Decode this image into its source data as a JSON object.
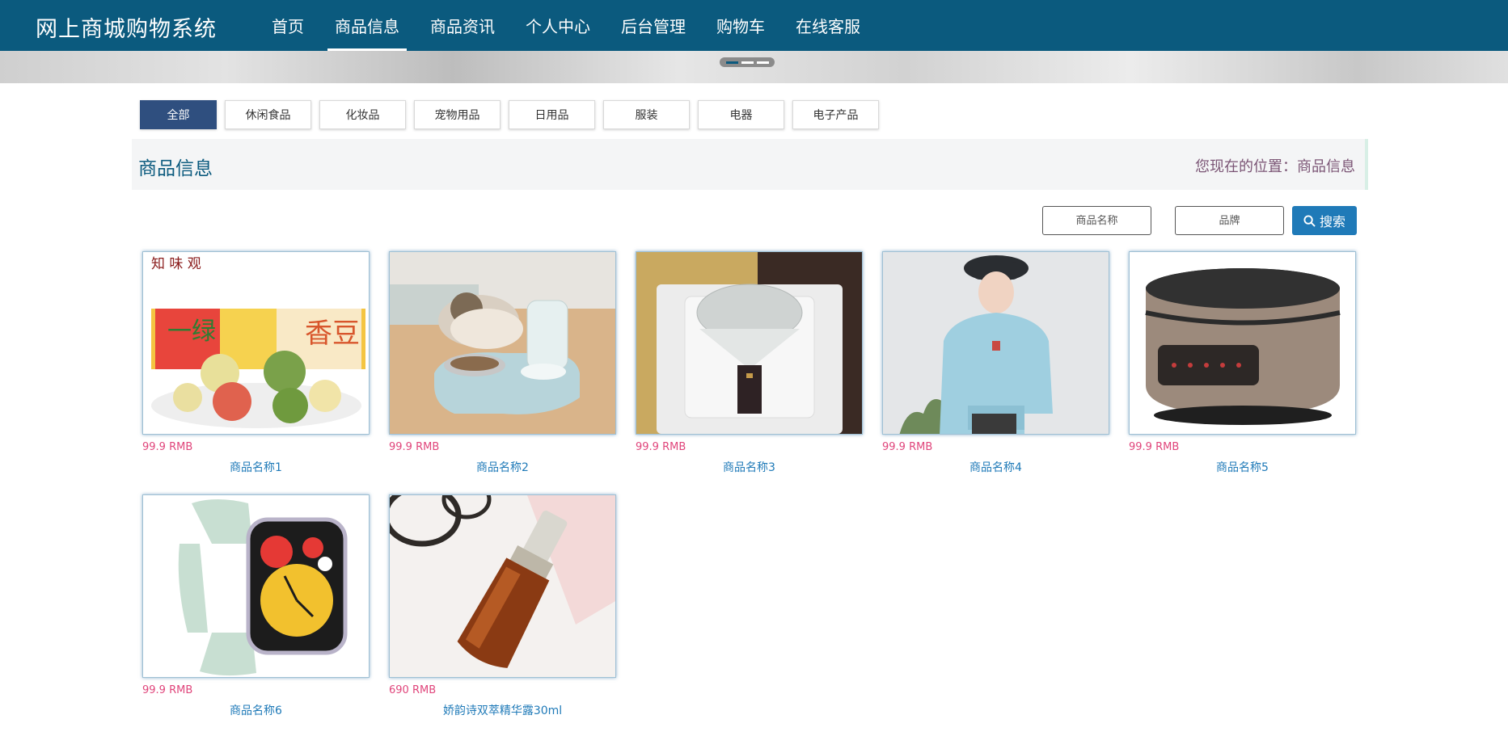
{
  "header": {
    "brand": "网上商城购物系统",
    "nav": [
      {
        "label": "首页"
      },
      {
        "label": "商品信息"
      },
      {
        "label": "商品资讯"
      },
      {
        "label": "个人中心"
      },
      {
        "label": "后台管理"
      },
      {
        "label": "购物车"
      },
      {
        "label": "在线客服"
      }
    ],
    "active_nav": "商品信息"
  },
  "categories": [
    {
      "label": "全部"
    },
    {
      "label": "休闲食品"
    },
    {
      "label": "化妆品"
    },
    {
      "label": "宠物用品"
    },
    {
      "label": "日用品"
    },
    {
      "label": "服装"
    },
    {
      "label": "电器"
    },
    {
      "label": "电子产品"
    }
  ],
  "section": {
    "title": "商品信息",
    "crumb_prefix": "您现在的位置：",
    "crumb_current": "商品信息"
  },
  "search": {
    "name_placeholder": "商品名称",
    "brand_placeholder": "品牌",
    "button_label": "搜索"
  },
  "products": [
    {
      "price": "99.9 RMB",
      "name": "商品名称1",
      "image": "mooncakes"
    },
    {
      "price": "99.9 RMB",
      "name": "商品名称2",
      "image": "cat-feeder"
    },
    {
      "price": "99.9 RMB",
      "name": "商品名称3",
      "image": "scale"
    },
    {
      "price": "99.9 RMB",
      "name": "商品名称4",
      "image": "hoodie"
    },
    {
      "price": "99.9 RMB",
      "name": "商品名称5",
      "image": "rice-cooker"
    },
    {
      "price": "99.9 RMB",
      "name": "商品名称6",
      "image": "smartwatch"
    },
    {
      "price": "690 RMB",
      "name": "娇韵诗双萃精华露30ml",
      "image": "serum"
    }
  ],
  "colors": {
    "header_bg": "#0b5a7e",
    "active_category": "#2f4f7f",
    "price": "#e0457b",
    "product_name": "#1f7ab8",
    "search_button": "#1f7ab8"
  },
  "icons": {
    "search_button": "search-icon"
  }
}
